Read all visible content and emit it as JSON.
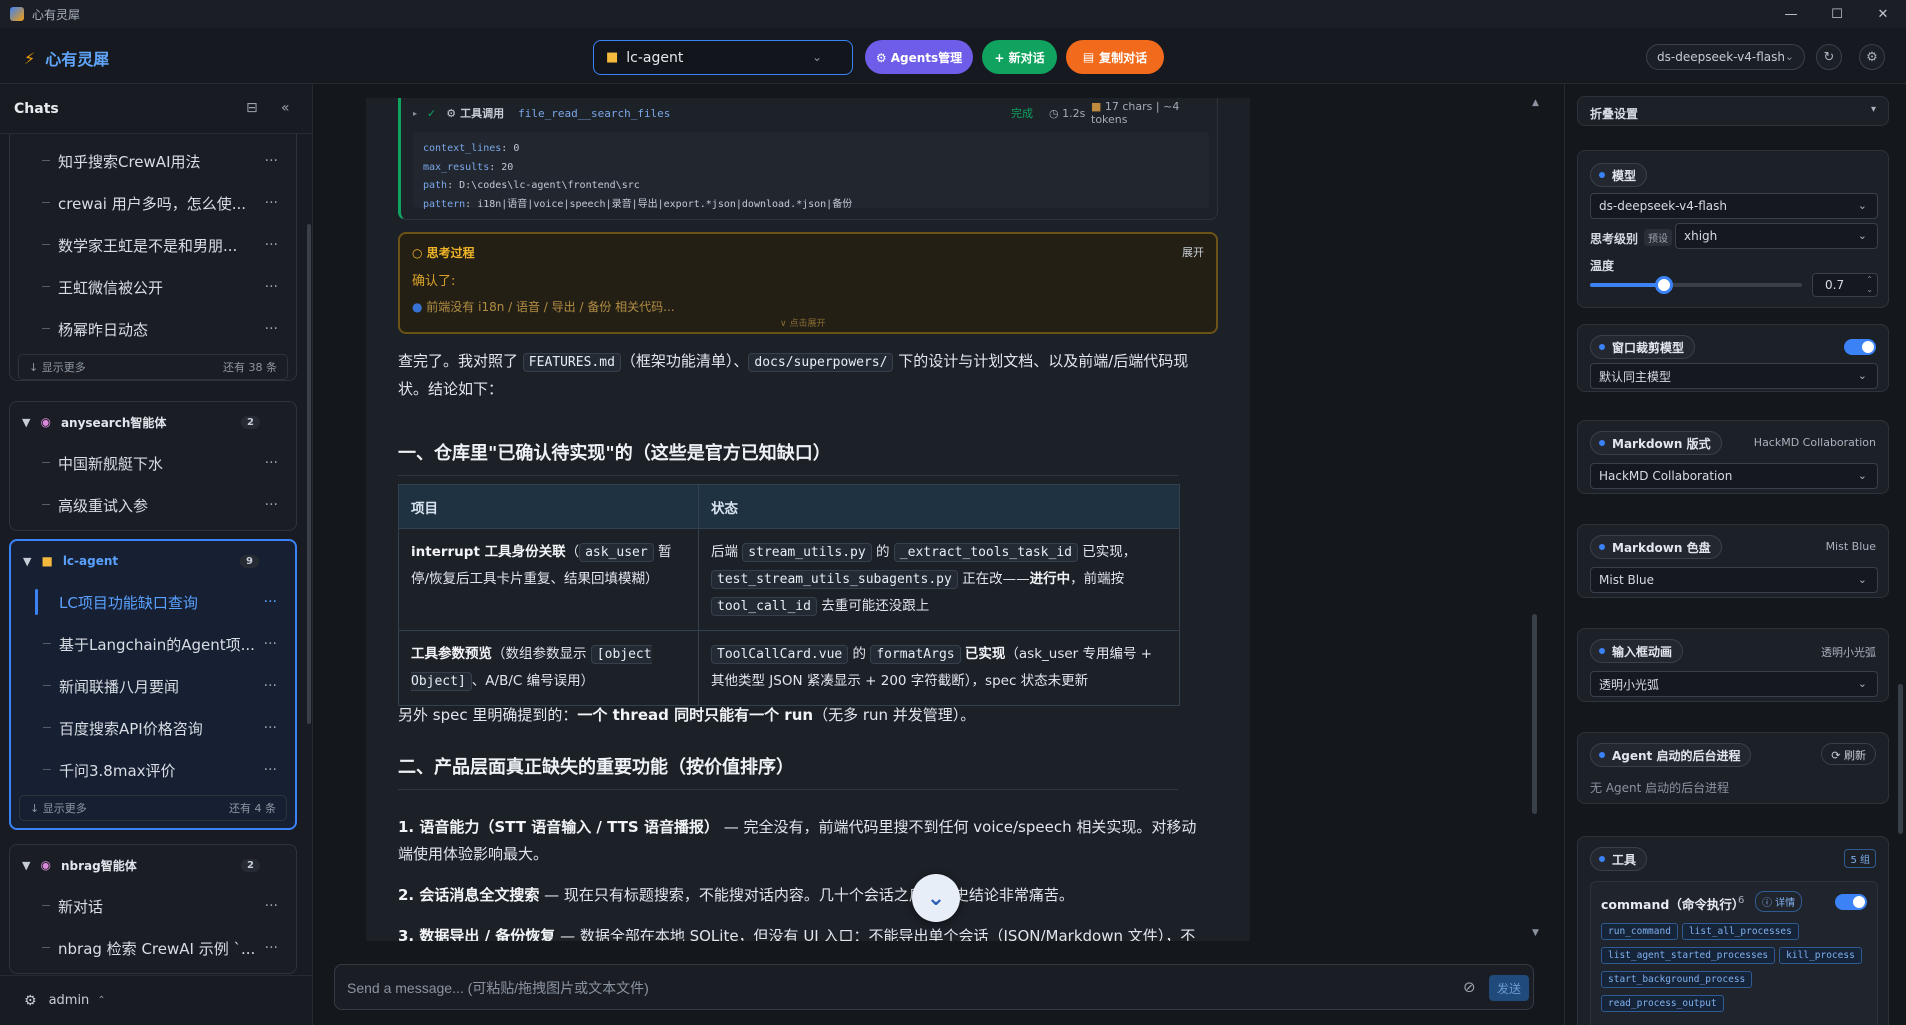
{
  "window": {
    "title": "心有灵犀",
    "minimize": "—",
    "maximize": "☐",
    "close": "✕"
  },
  "header": {
    "brand": "心有灵犀",
    "project": "lc-agent",
    "agents_btn": "⚙ Agents管理",
    "new_btn": "+ 新对话",
    "copy_btn": "复制对话",
    "model": "ds-deepseek-v4-flash"
  },
  "sidebar": {
    "title": "Chats",
    "groups": [
      {
        "items": [
          "知乎搜索CrewAI用法",
          "crewai 用户多吗，怎么使...",
          "数学家王虹是不是和男朋...",
          "王虹微信被公开",
          "杨幂昨日动态"
        ],
        "show_more": "↓ 显示更多",
        "rest": "还有 38 条"
      },
      {
        "name": "anysearch智能体",
        "count": "2",
        "items": [
          "中国新舰艇下水",
          "高级重试入参"
        ]
      },
      {
        "name": "lc-agent",
        "count": "9",
        "items": [
          "LC项目功能缺口查询",
          "基于Langchain的Agent项...",
          "新闻联播八月要闻",
          "百度搜索API价格咨询",
          "千问3.8max评价"
        ],
        "show_more": "↓ 显示更多",
        "rest": "还有 4 条"
      },
      {
        "name": "nbrag智能体",
        "count": "2",
        "items": [
          "新对话",
          "nbrag 检索 CrewAI 示例 `..."
        ]
      }
    ],
    "user": "admin"
  },
  "tool_call": {
    "label": "工具调用",
    "functions": "file_read__search_files",
    "status": "完成",
    "duration": "1.2s",
    "chars": "17 chars | ~4 tokens",
    "params": [
      {
        "k": "context_lines",
        "v": "0"
      },
      {
        "k": "max_results",
        "v": "20"
      },
      {
        "k": "path",
        "v": "D:\\codes\\lc-agent\\frontend\\src"
      },
      {
        "k": "pattern",
        "v": "i18n|语音|voice|speech|录音|导出|export.*json|download.*json|备份"
      }
    ]
  },
  "thinking": {
    "title": "思考过程",
    "expand": "展开",
    "line1": "确认了:",
    "line2": "前端没有 i18n / 语音 / 导出 / 备份 相关代码...",
    "more": "∨ 点击展开"
  },
  "message": {
    "intro_a": "查完了。我对照了",
    "intro_code1": "FEATURES.md",
    "intro_b": "（框架功能清单）、",
    "intro_code2": "docs/superpowers/",
    "intro_c": "下的设计与计划文档、以及前端/后端代码现状。结论如下：",
    "h2_1": "一、仓库里\"已确认待实现\"的（这些是官方已知缺口）",
    "table_headers": [
      "项目",
      "状态"
    ],
    "row1_c1_bold": "interrupt 工具身份关联",
    "row1_c1_a": "（",
    "row1_c1_code": "ask_user",
    "row1_c1_b": "暂停/恢复后工具卡片重复、结果回填模糊）",
    "row1_c2_a": "后端",
    "row1_c2_code1": "stream_utils.py",
    "row1_c2_b": "的",
    "row1_c2_code2": "_extract_tools_task_id",
    "row1_c2_c": "已实现，",
    "row1_c2_code3": "test_stream_utils_subagents.py",
    "row1_c2_d": "正在改——",
    "row1_c2_bold": "进行中",
    "row1_c2_e": "，前端按",
    "row1_c2_code4": "tool_call_id",
    "row1_c2_f": "去重可能还没跟上",
    "row2_c1_bold": "工具参数预览",
    "row2_c1_a": "（数组参数显示",
    "row2_c1_code": "[object Object]",
    "row2_c1_b": "、A/B/C 编号误用）",
    "row2_c2_code1": "ToolCallCard.vue",
    "row2_c2_a": "的",
    "row2_c2_code2": "formatArgs",
    "row2_c2_bold": "已实现",
    "row2_c2_b": "（ask_user 专用编号 + 其他类型 JSON 紧凑显示 + 200 字符截断），spec 状态未更新",
    "spec_a": "另外 spec 里明确提到的：",
    "spec_bold": "一个 thread 同时只能有一个 run",
    "spec_b": "（无多 run 并发管理）。",
    "h2_2": "二、产品层面真正缺失的重要功能（按价值排序）",
    "item1_bold": "1. 语音能力（STT 语音输入 / TTS 语音播报）",
    "item1_text": "— 完全没有，前端代码里搜不到任何 voice/speech 相关实现。对移动端使用体验影响最大。",
    "item2_bold": "2. 会话消息全文搜索",
    "item2_text": "— 现在只有标题搜索，不能搜对话内容。几十个会话之后找历史结论非常痛苦。",
    "item3_bold": "3. 数据导出 / 备份恢复",
    "item3_text": "— 数据全部在本地 SQLite，但没有 UI 入口：不能导出单个会话（JSON/Markdown 文件），不"
  },
  "composer": {
    "placeholder": "Send a message... (可粘贴/拖拽图片或文本文件)",
    "send": "发送"
  },
  "rpanel": {
    "fold_title": "折叠设置",
    "model_label": "模型",
    "model_value": "ds-deepseek-v4-flash",
    "think_label": "思考级别",
    "think_tag": "预设",
    "think_value": "xhigh",
    "temp_label": "温度",
    "temp_value": "0.7",
    "temp_fraction": 0.35,
    "crop_label": "窗口裁剪模型",
    "crop_value": "默认同主模型",
    "md_style_label": "Markdown 版式",
    "md_style_note": "HackMD Collaboration",
    "md_style_value": "HackMD Collaboration",
    "md_color_label": "Markdown 色盘",
    "md_color_note": "Mist Blue",
    "md_color_value": "Mist Blue",
    "input_anim_label": "输入框动画",
    "input_anim_note": "透明小光弧",
    "input_anim_value": "透明小光弧",
    "bg_label": "Agent 启动的后台进程",
    "bg_refresh": "⟳ 刷新",
    "bg_empty": "无 Agent 启动的后台进程",
    "tools_label": "工具",
    "tools_count": "5 组",
    "cmd_title": "command（命令执行）",
    "cmd_count": "6",
    "cmd_detail": "ⓘ 详情",
    "cmd_tools": [
      "run_command",
      "list_all_processes",
      "list_agent_started_processes",
      "kill_process",
      "start_background_process",
      "read_process_output"
    ]
  }
}
